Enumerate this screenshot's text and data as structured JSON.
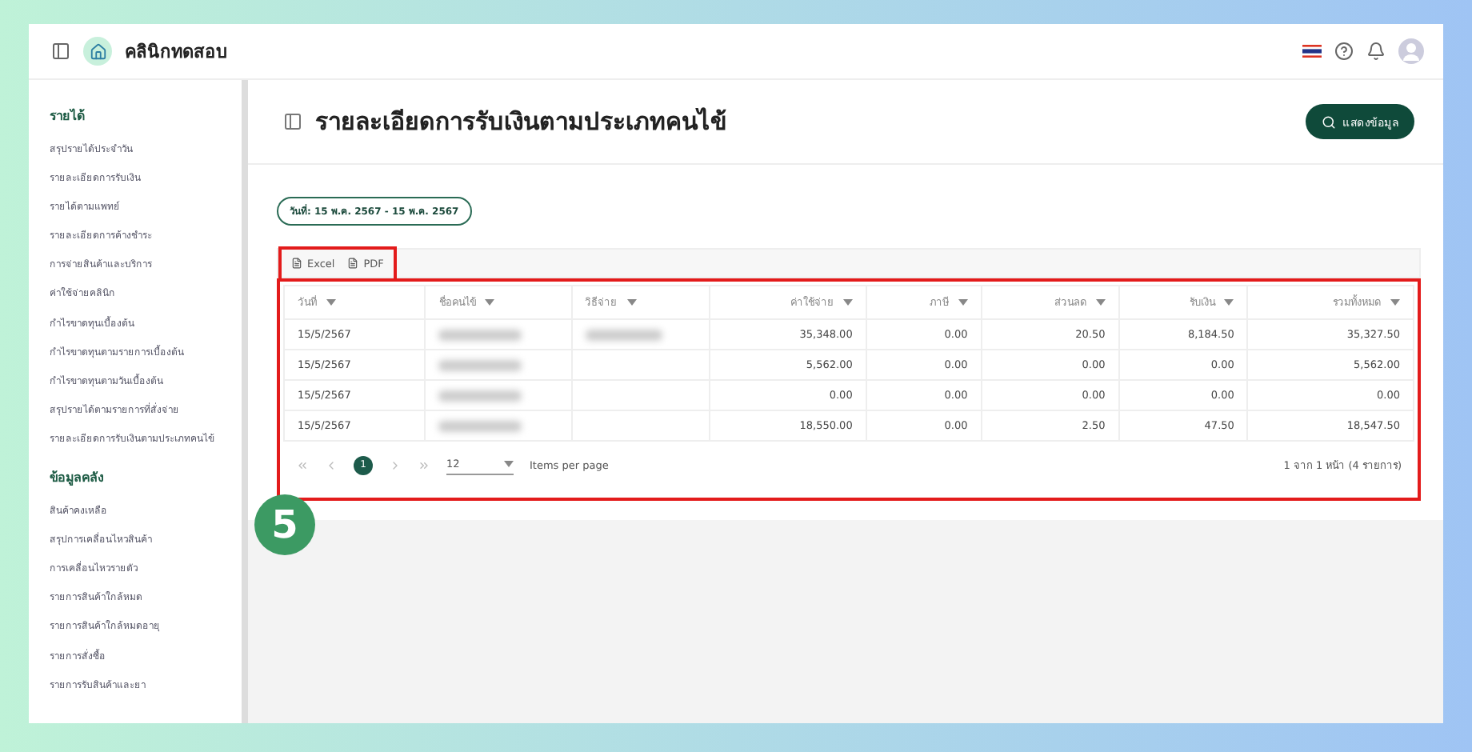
{
  "app": {
    "name": "คลินิกทดสอบ"
  },
  "sidebar": {
    "sections": [
      {
        "title": "รายได้",
        "items": [
          "สรุปรายได้ประจำวัน",
          "รายละเอียดการรับเงิน",
          "รายได้ตามแพทย์",
          "รายละเอียดการค้างชำระ",
          "การจ่ายสินค้าและบริการ",
          "ค่าใช้จ่ายคลินิก",
          "กำไรขาดทุนเบื้องต้น",
          "กำไรขาดทุนตามรายการเบื้องต้น",
          "กำไรขาดทุนตามวันเบื้องต้น",
          "สรุปรายได้ตามรายการที่สั่งจ่าย",
          "รายละเอียดการรับเงินตามประเภทคนไข้"
        ]
      },
      {
        "title": "ข้อมูลคลัง",
        "items": [
          "สินค้าคงเหลือ",
          "สรุปการเคลื่อนไหวสินค้า",
          "การเคลื่อนไหวรายตัว",
          "รายการสินค้าใกล้หมด",
          "รายการสินค้าใกล้หมดอายุ",
          "รายการสั่งซื้อ",
          "รายการรับสินค้าและยา"
        ]
      }
    ]
  },
  "page": {
    "title": "รายละเอียดการรับเงินตามประเภทคนไข้",
    "show_button": "แสดงข้อมูล",
    "date_range": "วันที่: 15 พ.ค. 2567 - 15 พ.ค. 2567"
  },
  "export": [
    "Excel",
    "PDF"
  ],
  "table": {
    "columns": [
      "วันที่",
      "ชื่อคนไข้",
      "วิธีจ่าย",
      "ค่าใช้จ่าย",
      "ภาษี",
      "ส่วนลด",
      "รับเงิน",
      "รวมทั้งหมด"
    ],
    "rows": [
      {
        "cells": [
          "15/5/2567",
          {
            "kind": "redacted"
          },
          {
            "kind": "redacted"
          },
          "35,348.00",
          "0.00",
          "20.50",
          "8,184.50",
          "35,327.50"
        ]
      },
      {
        "cells": [
          "15/5/2567",
          {
            "kind": "redacted"
          },
          null,
          "5,562.00",
          "0.00",
          "0.00",
          "0.00",
          "5,562.00"
        ]
      },
      {
        "cells": [
          "15/5/2567",
          {
            "kind": "redacted"
          },
          null,
          "0.00",
          "0.00",
          "0.00",
          "0.00",
          "0.00"
        ]
      },
      {
        "cells": [
          "15/5/2567",
          {
            "kind": "redacted"
          },
          null,
          "18,550.00",
          "0.00",
          "2.50",
          "47.50",
          "18,547.50"
        ]
      }
    ]
  },
  "pager": {
    "pages": [
      {
        "label": "1",
        "selected": true
      }
    ],
    "page_size": "12",
    "page_size_label": "Items per page",
    "summary": "1 จาก 1 หน้า (4 รายการ)"
  },
  "annotation": {
    "step": "5"
  }
}
